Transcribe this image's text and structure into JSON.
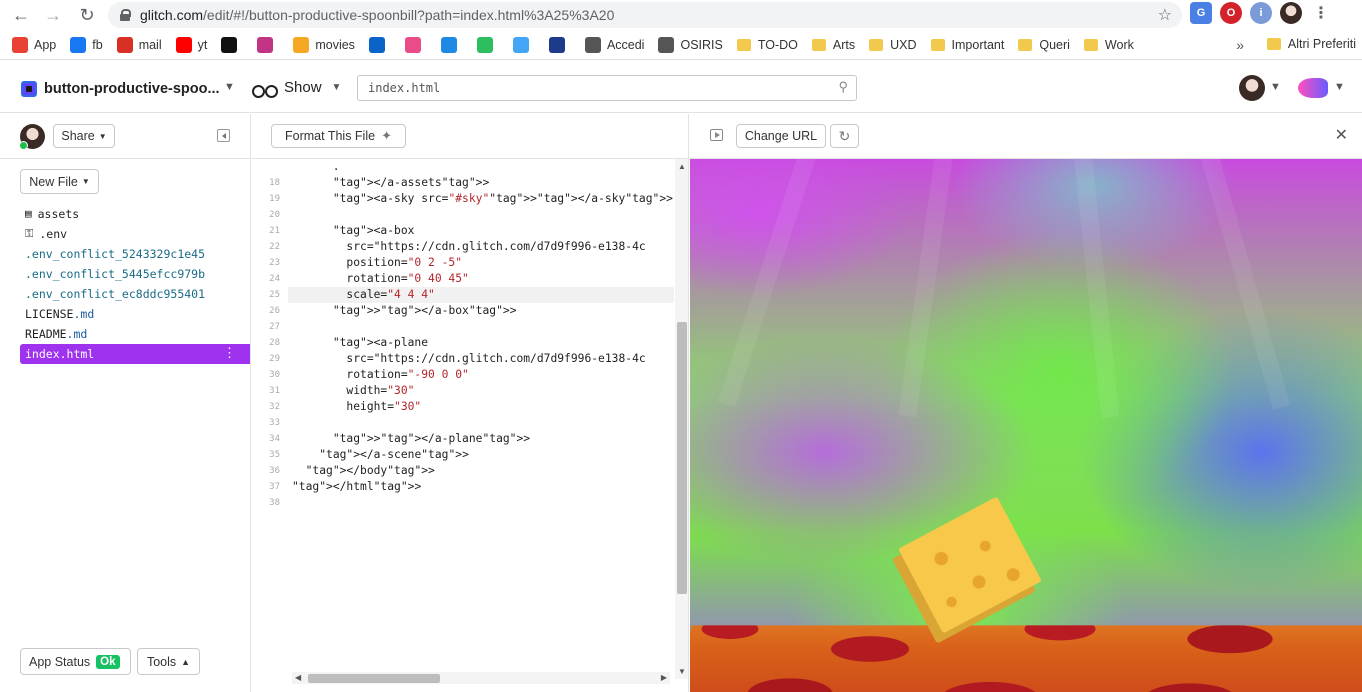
{
  "browser": {
    "url_host": "glitch.com",
    "url_path": "/edit/#!/button-productive-spoonbill?path=index.html%3A25%3A20",
    "bookmarks": [
      {
        "label": "App",
        "icon": "apps-grid-icon",
        "color": "#e94235"
      },
      {
        "label": "fb",
        "icon": "facebook-icon",
        "color": "#1877f2"
      },
      {
        "label": "mail",
        "icon": "gmail-icon",
        "color": "#d93025"
      },
      {
        "label": "yt",
        "icon": "youtube-icon",
        "color": "#ff0000"
      },
      {
        "label": "",
        "icon": "behance-icon",
        "color": "#111111"
      },
      {
        "label": "",
        "icon": "instagram-icon",
        "color": "#c13584"
      },
      {
        "label": "movies",
        "icon": "movies-icon",
        "color": "#f5a623"
      },
      {
        "label": "",
        "icon": "outlook-icon",
        "color": "#0a64c8"
      },
      {
        "label": "",
        "icon": "dribbble-icon",
        "color": "#ea4c89"
      },
      {
        "label": "",
        "icon": "layers-icon",
        "color": "#1e88e5"
      },
      {
        "label": "",
        "icon": "evernote-icon",
        "color": "#2dbe60"
      },
      {
        "label": "",
        "icon": "spinner-icon",
        "color": "#42a5f5"
      },
      {
        "label": "",
        "icon": "calendar-icon",
        "color": "#1e3a8a"
      },
      {
        "label": "Accedi",
        "icon": "globe-icon",
        "color": "#555555"
      },
      {
        "label": "OSIRIS",
        "icon": "globe-icon",
        "color": "#555555"
      }
    ],
    "folders": [
      "TO-DO",
      "Arts",
      "UXD",
      "Important",
      "Queri",
      "Work"
    ],
    "more_label": "»",
    "other_bookmarks": "Altri Preferiti"
  },
  "header": {
    "project_name": "button-productive-spoo...",
    "show_label": "Show",
    "search_value": "index.html"
  },
  "sidebar": {
    "share_label": "Share",
    "new_file_label": "New File",
    "files": [
      {
        "name": "assets",
        "icon": "archive-icon"
      },
      {
        "name": ".env",
        "icon": "key-icon"
      },
      {
        "name": ".env_conflict_5243329c1e45"
      },
      {
        "name": ".env_conflict_5445efcc979b"
      },
      {
        "name": ".env_conflict_ec8ddc955401"
      },
      {
        "name": "LICENSE",
        "ext": ".md"
      },
      {
        "name": "README",
        "ext": ".md"
      },
      {
        "name": "index.html",
        "active": true
      }
    ],
    "app_status_label": "App Status",
    "ok_label": "Ok",
    "tools_label": "Tools"
  },
  "editor": {
    "format_label": "Format This File",
    "lines": [
      {
        "n": "",
        "text": "      ."
      },
      {
        "n": "18",
        "text": "      </a-assets>"
      },
      {
        "n": "19",
        "text": "      <a-sky src=\"#sky\"></a-sky>"
      },
      {
        "n": "20",
        "text": ""
      },
      {
        "n": "21",
        "text": "      <a-box"
      },
      {
        "n": "22",
        "text": "        src=\"https://cdn.glitch.com/d7d9f996-e138-4c"
      },
      {
        "n": "23",
        "text": "        position=\"0 2 -5\""
      },
      {
        "n": "24",
        "text": "        rotation=\"0 40 45\""
      },
      {
        "n": "25",
        "text": "        scale=\"4 4 4\""
      },
      {
        "n": "26",
        "text": "      ></a-box>"
      },
      {
        "n": "27",
        "text": ""
      },
      {
        "n": "28",
        "text": "      <a-plane"
      },
      {
        "n": "29",
        "text": "        src=\"https://cdn.glitch.com/d7d9f996-e138-4c"
      },
      {
        "n": "30",
        "text": "        rotation=\"-90 0 0\""
      },
      {
        "n": "31",
        "text": "        width=\"30\""
      },
      {
        "n": "32",
        "text": "        height=\"30\""
      },
      {
        "n": "33",
        "text": ""
      },
      {
        "n": "34",
        "text": "      ></a-plane>"
      },
      {
        "n": "35",
        "text": "    </a-scene>"
      },
      {
        "n": "36",
        "text": "  </body>"
      },
      {
        "n": "37",
        "text": "</html>"
      },
      {
        "n": "38",
        "text": ""
      }
    ],
    "highlight_line": "25"
  },
  "preview": {
    "change_url_label": "Change URL"
  }
}
